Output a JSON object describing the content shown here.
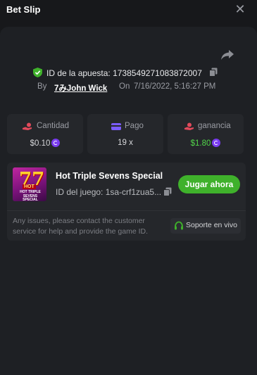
{
  "header": {
    "title": "Bet Slip"
  },
  "bet": {
    "id_label": "ID de la apuesta:",
    "id_value": "1738549271083872007",
    "by_label": "By",
    "user": "7みJohn Wick",
    "on_label": "On",
    "date": "7/16/2022, 5:16:27 PM"
  },
  "stats": [
    {
      "label": "Cantidad",
      "value": "$0.10",
      "icon": "coins-hand-icon",
      "color": "#e24a5b"
    },
    {
      "label": "Pago",
      "value": "19 x",
      "icon": "card-icon",
      "color": "#7b5cff"
    },
    {
      "label": "ganancia",
      "value": "$1.80",
      "icon": "profit-hand-icon",
      "color": "#e24a5b",
      "value_color": "#52d64a"
    }
  ],
  "game": {
    "name": "Hot Triple Sevens Special",
    "id_label": "ID del juego: 1sa-crf1zua5...",
    "play_label": "Jugar ahora",
    "thumb_hot": "HOT",
    "thumb_caption": "HOT TRIPLE SEVENS SPECIAL"
  },
  "support": {
    "message": "Any issues, please contact the customer service for help and provide the game ID.",
    "button_label": "Soporte en vivo"
  },
  "colors": {
    "accent_green": "#3fb12b",
    "coin": "#7a3cf0",
    "background": "#17181b",
    "panel": "#1e2024",
    "card": "#25272b"
  }
}
